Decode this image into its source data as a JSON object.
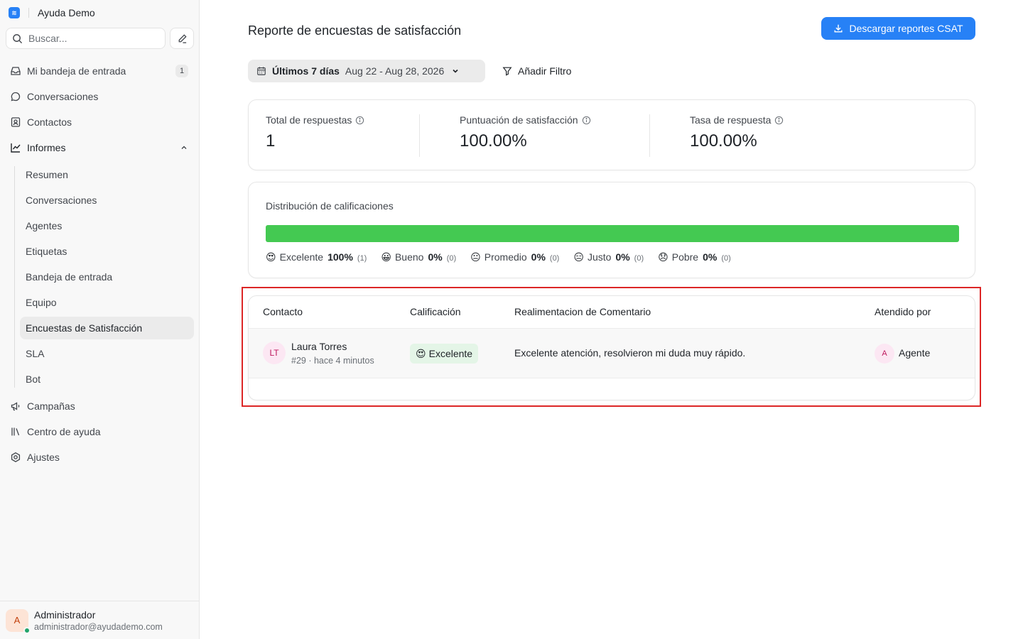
{
  "app": {
    "name": "Ayuda Demo"
  },
  "search": {
    "placeholder": "Buscar..."
  },
  "sidebar": {
    "inbox": {
      "label": "Mi bandeja de entrada",
      "badge": "1"
    },
    "conversations": {
      "label": "Conversaciones"
    },
    "contacts": {
      "label": "Contactos"
    },
    "reports": {
      "label": "Informes",
      "items": [
        {
          "label": "Resumen"
        },
        {
          "label": "Conversaciones"
        },
        {
          "label": "Agentes"
        },
        {
          "label": "Etiquetas"
        },
        {
          "label": "Bandeja de entrada"
        },
        {
          "label": "Equipo"
        },
        {
          "label": "Encuestas de Satisfacción",
          "selected": true
        },
        {
          "label": "SLA"
        },
        {
          "label": "Bot"
        }
      ]
    },
    "campaigns": {
      "label": "Campañas"
    },
    "help_center": {
      "label": "Centro de ayuda"
    },
    "settings": {
      "label": "Ajustes"
    }
  },
  "profile": {
    "initial": "A",
    "name": "Administrador",
    "email": "administrador@ayudademo.com"
  },
  "page": {
    "title": "Reporte de encuestas de satisfacción"
  },
  "toolbar": {
    "download_label": "Descargar reportes CSAT",
    "date_label": "Últimos 7 días",
    "date_range": "Aug 22 - Aug 28, 2026",
    "filter_label": "Añadir Filtro"
  },
  "metrics": [
    {
      "label": "Total de respuestas",
      "value": "1"
    },
    {
      "label": "Puntuación de satisfacción",
      "value": "100.00%"
    },
    {
      "label": "Tasa de respuesta",
      "value": "100.00%"
    }
  ],
  "distribution": {
    "title": "Distribución de calificaciones",
    "bar_color": "#44c952",
    "ratings": [
      {
        "emoji": "😍",
        "name": "Excelente",
        "pct": "100%",
        "count": "(1)",
        "share": 1.0
      },
      {
        "emoji": "😀",
        "name": "Bueno",
        "pct": "0%",
        "count": "(0)",
        "share": 0
      },
      {
        "emoji": "😐",
        "name": "Promedio",
        "pct": "0%",
        "count": "(0)",
        "share": 0
      },
      {
        "emoji": "😑",
        "name": "Justo",
        "pct": "0%",
        "count": "(0)",
        "share": 0
      },
      {
        "emoji": "😞",
        "name": "Pobre",
        "pct": "0%",
        "count": "(0)",
        "share": 0
      }
    ]
  },
  "table": {
    "headers": {
      "contact": "Contacto",
      "rating": "Calificación",
      "feedback": "Realimentacion de Comentario",
      "agent": "Atendido por"
    },
    "rows": [
      {
        "initials": "LT",
        "name": "Laura Torres",
        "meta": "#29 · hace 4 minutos",
        "rating_emoji": "😍",
        "rating": "Excelente",
        "feedback": "Excelente atención, resolvieron mi duda muy rápido.",
        "agent_initial": "A",
        "agent": "Agente"
      }
    ]
  },
  "colors": {
    "accent": "#2781f6",
    "highlight": "#dc2626",
    "positive": "#44c952"
  }
}
